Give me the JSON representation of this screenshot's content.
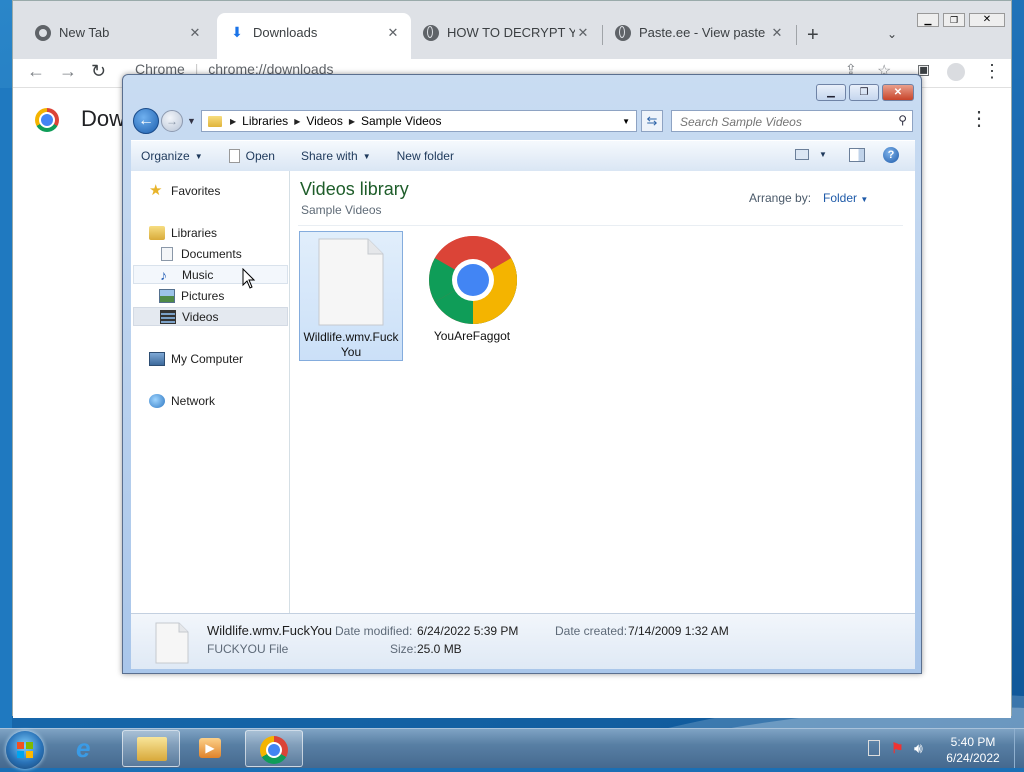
{
  "colors": {
    "library_title": "#1e5d2a",
    "link_blue": "#1e5aa8"
  },
  "chrome": {
    "tabs": [
      {
        "title": "New Tab",
        "icon": "chrome-icon"
      },
      {
        "title": "Downloads",
        "icon": "download-icon"
      },
      {
        "title": "HOW TO DECRYPT YOUR",
        "icon": "globe-icon"
      },
      {
        "title": "Paste.ee - View paste W",
        "icon": "globe-icon"
      }
    ],
    "new_tab_label": "+",
    "address_scheme": "Chrome",
    "address_url": "chrome://downloads",
    "page_title": "Dow"
  },
  "explorer": {
    "breadcrumbs": [
      "Libraries",
      "Videos",
      "Sample Videos"
    ],
    "search_placeholder": "Search Sample Videos",
    "toolbar": {
      "organize": "Organize",
      "open": "Open",
      "share_with": "Share with",
      "new_folder": "New folder"
    },
    "nav": {
      "favorites": "Favorites",
      "libraries": "Libraries",
      "documents": "Documents",
      "music": "Music",
      "pictures": "Pictures",
      "videos": "Videos",
      "my_computer": "My Computer",
      "network": "Network"
    },
    "library_title": "Videos library",
    "library_subtitle": "Sample Videos",
    "arrange_label": "Arrange by:",
    "arrange_value": "Folder",
    "files": [
      {
        "name": "Wildlife.wmv.FuckYou",
        "icon": "blank-file-icon",
        "selected": true
      },
      {
        "name": "YouAreFaggot",
        "icon": "chrome-icon",
        "selected": false
      }
    ],
    "details": {
      "name": "Wildlife.wmv.FuckYou",
      "type": "FUCKYOU File",
      "date_modified_label": "Date modified:",
      "date_modified": "6/24/2022 5:39 PM",
      "date_created_label": "Date created:",
      "date_created": "7/14/2009 1:32 AM",
      "size_label": "Size:",
      "size": "25.0 MB"
    }
  },
  "taskbar": {
    "time": "5:40 PM",
    "date": "6/24/2022"
  }
}
